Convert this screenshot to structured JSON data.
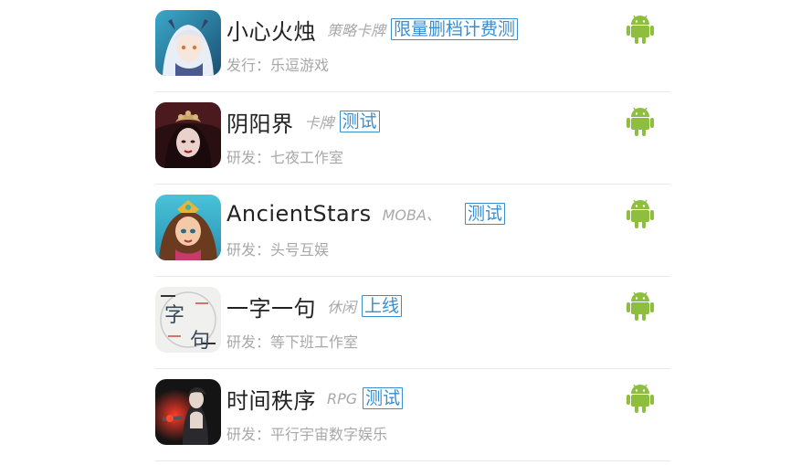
{
  "accent_badge": "#3a8ecf",
  "android_color": "#8dbe3f",
  "games": [
    {
      "name": "小心火烛",
      "genre": "策略卡牌",
      "badge": "限量删档计费测",
      "sub_label": "发行：",
      "sub_value": "乐逗游戏",
      "platform_icon": "android-icon"
    },
    {
      "name": "阴阳界",
      "genre": "卡牌",
      "badge": "测试",
      "sub_label": "研发：",
      "sub_value": "七夜工作室",
      "platform_icon": "android-icon"
    },
    {
      "name": "AncientStars",
      "genre": "MOBA、",
      "badge": "测试",
      "sub_label": "研发：",
      "sub_value": "头号互娱",
      "platform_icon": "android-icon"
    },
    {
      "name": "一字一句",
      "genre": "休闲",
      "badge": "上线",
      "sub_label": "研发：",
      "sub_value": "等下班工作室",
      "platform_icon": "android-icon"
    },
    {
      "name": "时间秩序",
      "genre": "RPG",
      "badge": "测试",
      "sub_label": "研发：",
      "sub_value": "平行宇宙数字娱乐",
      "platform_icon": "android-icon"
    }
  ],
  "logo_text": {
    "g4_top": "字",
    "g4_bottom": "句"
  }
}
